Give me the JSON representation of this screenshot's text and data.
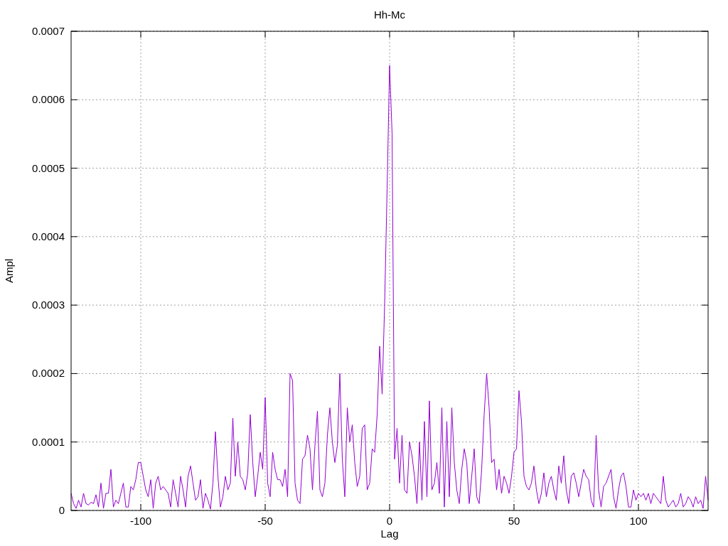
{
  "plot": {
    "chart_data": {
      "type": "line",
      "title": "Hh-Mc",
      "xlabel": "Lag",
      "ylabel": "Ampl",
      "grid": true,
      "xlim": [
        -128,
        128
      ],
      "ylim": [
        0,
        0.0007
      ],
      "x": [
        -128,
        -127,
        -126,
        -125,
        -124,
        -123,
        -122,
        -121,
        -120,
        -119,
        -118,
        -117,
        -116,
        -115,
        -114,
        -113,
        -112,
        -111,
        -110,
        -109,
        -108,
        -107,
        -106,
        -105,
        -104,
        -103,
        -102,
        -101,
        -100,
        -99,
        -98,
        -97,
        -96,
        -95,
        -94,
        -93,
        -92,
        -91,
        -90,
        -89,
        -88,
        -87,
        -86,
        -85,
        -84,
        -83,
        -82,
        -81,
        -80,
        -79,
        -78,
        -77,
        -76,
        -75,
        -74,
        -73,
        -72,
        -71,
        -70,
        -69,
        -68,
        -67,
        -66,
        -65,
        -64,
        -63,
        -62,
        -61,
        -60,
        -59,
        -58,
        -57,
        -56,
        -55,
        -54,
        -53,
        -52,
        -51,
        -50,
        -49,
        -48,
        -47,
        -46,
        -45,
        -44,
        -43,
        -42,
        -41,
        -40,
        -39,
        -38,
        -37,
        -36,
        -35,
        -34,
        -33,
        -32,
        -31,
        -30,
        -29,
        -28,
        -27,
        -26,
        -25,
        -24,
        -23,
        -22,
        -21,
        -20,
        -19,
        -18,
        -17,
        -16,
        -15,
        -14,
        -13,
        -12,
        -11,
        -10,
        -9,
        -8,
        -7,
        -6,
        -5,
        -4,
        -3,
        -2,
        -1,
        0,
        1,
        2,
        3,
        4,
        5,
        6,
        7,
        8,
        9,
        10,
        11,
        12,
        13,
        14,
        15,
        16,
        17,
        18,
        19,
        20,
        21,
        22,
        23,
        24,
        25,
        26,
        27,
        28,
        29,
        30,
        31,
        32,
        33,
        34,
        35,
        36,
        37,
        38,
        39,
        40,
        41,
        42,
        43,
        44,
        45,
        46,
        47,
        48,
        49,
        50,
        51,
        52,
        53,
        54,
        55,
        56,
        57,
        58,
        59,
        60,
        61,
        62,
        63,
        64,
        65,
        66,
        67,
        68,
        69,
        70,
        71,
        72,
        73,
        74,
        75,
        76,
        77,
        78,
        79,
        80,
        81,
        82,
        83,
        84,
        85,
        86,
        87,
        88,
        89,
        90,
        91,
        92,
        93,
        94,
        95,
        96,
        97,
        98,
        99,
        100,
        101,
        102,
        103,
        104,
        105,
        106,
        107,
        108,
        109,
        110,
        111,
        112,
        113,
        114,
        115,
        116,
        117,
        118,
        119,
        120,
        121,
        122,
        123,
        124,
        125,
        126,
        127,
        128
      ],
      "xticks": [
        -100,
        -50,
        0,
        50,
        100
      ],
      "yticks": [
        {
          "value": 0,
          "label": "0"
        },
        {
          "value": 0.0001,
          "label": "0.0001"
        },
        {
          "value": 0.0002,
          "label": "0.0002"
        },
        {
          "value": 0.0003,
          "label": "0.0003"
        },
        {
          "value": 0.0004,
          "label": "0.0004"
        },
        {
          "value": 0.0005,
          "label": "0.0005"
        },
        {
          "value": 0.0006,
          "label": "0.0006"
        },
        {
          "value": 0.0007,
          "label": "0.0007"
        }
      ],
      "series": [
        {
          "color": "#9400d3",
          "values": [
            2.5e-05,
            1e-05,
            3e-06,
            1.5e-05,
            5e-06,
            2.5e-05,
            1e-05,
            8e-06,
            1.2e-05,
            1e-05,
            2.3e-05,
            5e-06,
            4e-05,
            3e-06,
            2.5e-05,
            2.5e-05,
            6e-05,
            5e-06,
            1.5e-05,
            1e-05,
            2.5e-05,
            4e-05,
            5e-06,
            5e-06,
            3.5e-05,
            3e-05,
            4.5e-05,
            7e-05,
            7e-05,
            5e-05,
            3e-05,
            2e-05,
            4.5e-05,
            3e-06,
            4e-05,
            5e-05,
            3e-05,
            3.5e-05,
            3e-05,
            2.5e-05,
            5e-06,
            4.5e-05,
            2.5e-05,
            5e-06,
            5e-05,
            3e-05,
            5e-06,
            5e-05,
            6.5e-05,
            4e-05,
            1.5e-05,
            2e-05,
            4.5e-05,
            3e-06,
            2.5e-05,
            1.5e-05,
            2e-06,
            4e-05,
            0.000115,
            5e-05,
            5e-06,
            2e-05,
            5e-05,
            3e-05,
            4e-05,
            0.000135,
            5e-05,
            0.0001,
            5e-05,
            4.5e-05,
            3e-05,
            5.5e-05,
            0.00014,
            7e-05,
            2e-05,
            5e-05,
            8.5e-05,
            6e-05,
            0.000165,
            4e-05,
            2e-05,
            8.5e-05,
            6e-05,
            4.5e-05,
            4.5e-05,
            3.5e-05,
            6e-05,
            2e-05,
            0.0002,
            0.00019,
            4e-05,
            1.5e-05,
            1e-05,
            7.5e-05,
            8e-05,
            0.00011,
            9e-05,
            3e-05,
            9.5e-05,
            0.000145,
            3e-05,
            2e-05,
            4e-05,
            0.00011,
            0.00015,
            0.0001,
            7e-05,
            9.5e-05,
            0.0002,
            7.5e-05,
            2e-05,
            0.00015,
            0.0001,
            0.000125,
            7e-05,
            3.5e-05,
            5e-05,
            0.00012,
            0.000125,
            3e-05,
            4e-05,
            9e-05,
            8.5e-05,
            0.00014,
            0.00024,
            0.00017,
            0.0003,
            0.00047,
            0.00065,
            0.00055,
            7.5e-05,
            0.00012,
            4e-05,
            0.00011,
            3e-05,
            2.5e-05,
            0.0001,
            8e-05,
            5e-05,
            1e-05,
            0.0001,
            1.5e-05,
            0.00013,
            2e-05,
            0.00016,
            3e-05,
            4e-05,
            7e-05,
            2.5e-05,
            0.00015,
            5e-06,
            0.00013,
            2e-05,
            0.00015,
            7e-05,
            3e-05,
            1e-05,
            6e-05,
            9e-05,
            7e-05,
            1e-05,
            5e-05,
            9e-05,
            2e-05,
            1e-05,
            6e-05,
            0.00014,
            0.0002,
            0.00015,
            7e-05,
            7.5e-05,
            3e-05,
            6e-05,
            2.5e-05,
            5e-05,
            4e-05,
            2.5e-05,
            5e-05,
            8.5e-05,
            9e-05,
            0.000175,
            0.00013,
            5e-05,
            3.5e-05,
            3e-05,
            4e-05,
            6.5e-05,
            3e-05,
            1e-05,
            2.5e-05,
            5.5e-05,
            2e-05,
            4e-05,
            5e-05,
            3e-05,
            1.5e-05,
            6.5e-05,
            4e-05,
            8e-05,
            3e-05,
            1e-05,
            5e-05,
            5.5e-05,
            4e-05,
            2e-05,
            4e-05,
            6e-05,
            5e-05,
            4.5e-05,
            1.5e-05,
            5e-06,
            0.00011,
            3e-05,
            5e-06,
            3.5e-05,
            4e-05,
            5e-05,
            6e-05,
            2e-05,
            3e-06,
            3e-05,
            5e-05,
            5.5e-05,
            3.5e-05,
            5e-06,
            5e-06,
            3e-05,
            1.5e-05,
            2.5e-05,
            2e-05,
            2.5e-05,
            1.5e-05,
            2.5e-05,
            1e-05,
            2.5e-05,
            2e-05,
            1.5e-05,
            1e-05,
            5e-05,
            1.5e-05,
            5e-06,
            1e-05,
            1.5e-05,
            5e-06,
            1e-05,
            2.5e-05,
            5e-06,
            1e-05,
            2e-05,
            1.5e-05,
            5e-06,
            2e-05,
            1e-05,
            1.5e-05,
            3e-06,
            5e-05,
            1.5e-05
          ]
        }
      ]
    }
  }
}
